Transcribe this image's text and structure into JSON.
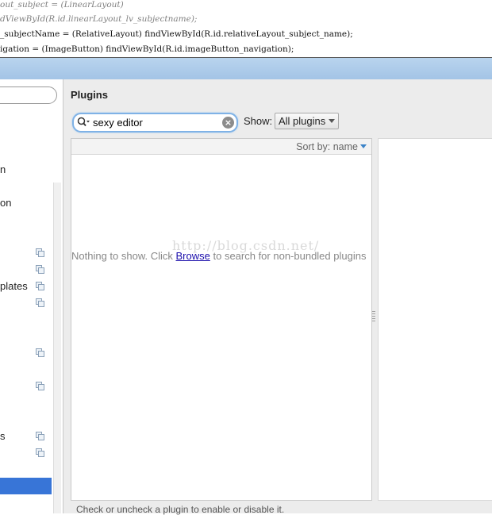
{
  "code_editor": {
    "lines": [
      "out_subject = (LinearLayout)",
      "dViewById(R.id.linearLayout_lv_subjectname);",
      "_subjectName = (RelativeLayout) findViewById(R.id.relativeLayout_subject_name);",
      "igation = (ImageButton) findViewById(R.id.imageButton_navigation);"
    ]
  },
  "left_tree": {
    "items": [
      {
        "label": "n"
      },
      {
        "label": "on"
      },
      {
        "label": "plates"
      },
      {
        "label": "s"
      }
    ]
  },
  "panel": {
    "title": "Plugins",
    "search": {
      "value": "sexy editor",
      "icon": "search-icon",
      "clear_icon": "clear-icon"
    },
    "show": {
      "label": "Show:",
      "selected": "All plugins"
    },
    "list": {
      "sort_label": "Sort by: name",
      "empty_prefix": "Nothing to show. Click ",
      "empty_link": "Browse",
      "empty_suffix": " to search for non-bundled plugins"
    },
    "watermark": "http://blog.csdn.net/",
    "footer_hint": "Check or uncheck a plugin to enable or disable it."
  },
  "colors": {
    "accent": "#3875d7",
    "search_focus": "#7fb2e6",
    "title_gradient": "#a3c4e6"
  }
}
